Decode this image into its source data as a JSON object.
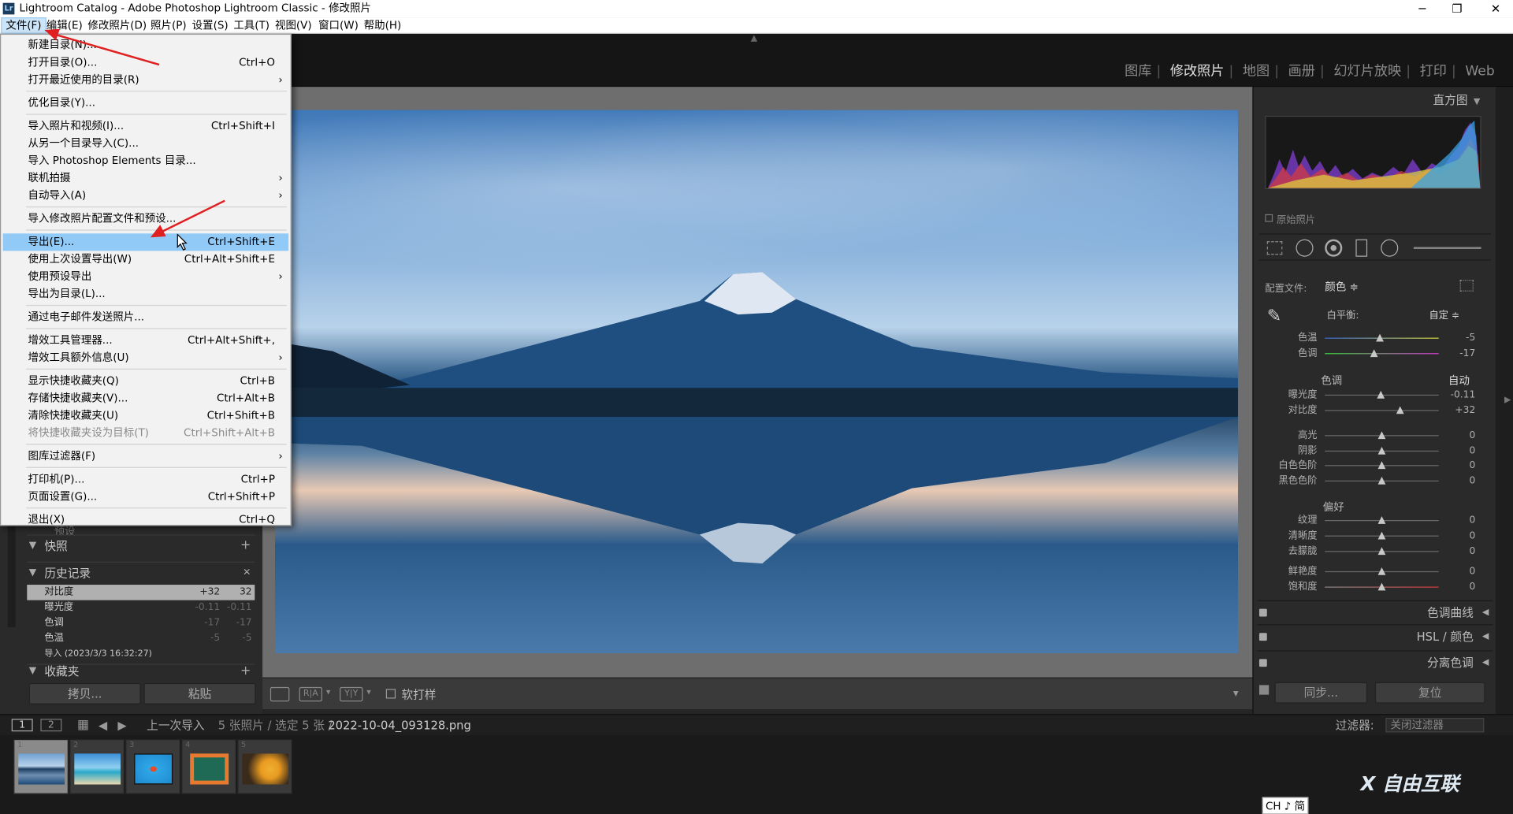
{
  "window": {
    "title": "Lightroom Catalog - Adobe Photoshop Lightroom Classic - 修改照片",
    "logo_text": "Lr",
    "minimize": "─",
    "maximize": "❐",
    "close": "✕"
  },
  "menubar": [
    "文件(F)",
    "编辑(E)",
    "修改照片(D)",
    "照片(P)",
    "设置(S)",
    "工具(T)",
    "视图(V)",
    "窗口(W)",
    "帮助(H)"
  ],
  "modules": [
    "图库",
    "修改照片",
    "地图",
    "画册",
    "幻灯片放映",
    "打印",
    "Web"
  ],
  "module_separator": "|",
  "file_menu": {
    "items": [
      {
        "label": "新建目录(N)...",
        "shortcut": ""
      },
      {
        "label": "打开目录(O)...",
        "shortcut": "Ctrl+O"
      },
      {
        "label": "打开最近使用的目录(R)",
        "shortcut": "",
        "submenu": true
      },
      {
        "label": "优化目录(Y)...",
        "shortcut": ""
      },
      {
        "label": "导入照片和视频(I)...",
        "shortcut": "Ctrl+Shift+I"
      },
      {
        "label": "从另一个目录导入(C)...",
        "shortcut": ""
      },
      {
        "label": "导入 Photoshop Elements 目录...",
        "shortcut": ""
      },
      {
        "label": "联机拍摄",
        "shortcut": "",
        "submenu": true
      },
      {
        "label": "自动导入(A)",
        "shortcut": "",
        "submenu": true
      },
      {
        "label": "导入修改照片配置文件和预设...",
        "shortcut": ""
      },
      {
        "label": "导出(E)...",
        "shortcut": "Ctrl+Shift+E",
        "highlighted": true
      },
      {
        "label": "使用上次设置导出(W)",
        "shortcut": "Ctrl+Alt+Shift+E"
      },
      {
        "label": "使用预设导出",
        "shortcut": "",
        "submenu": true
      },
      {
        "label": "导出为目录(L)...",
        "shortcut": ""
      },
      {
        "label": "通过电子邮件发送照片...",
        "shortcut": ""
      },
      {
        "label": "增效工具管理器...",
        "shortcut": "Ctrl+Alt+Shift+,"
      },
      {
        "label": "增效工具额外信息(U)",
        "shortcut": "",
        "submenu": true
      },
      {
        "label": "显示快捷收藏夹(Q)",
        "shortcut": "Ctrl+B"
      },
      {
        "label": "存储快捷收藏夹(V)...",
        "shortcut": "Ctrl+Alt+B"
      },
      {
        "label": "清除快捷收藏夹(U)",
        "shortcut": "Ctrl+Shift+B"
      },
      {
        "label": "将快捷收藏夹设为目标(T)",
        "shortcut": "Ctrl+Shift+Alt+B",
        "disabled": true
      },
      {
        "label": "图库过滤器(F)",
        "shortcut": "",
        "submenu": true
      },
      {
        "label": "打印机(P)...",
        "shortcut": "Ctrl+P"
      },
      {
        "label": "页面设置(G)...",
        "shortcut": "Ctrl+Shift+P"
      },
      {
        "label": "退出(X)",
        "shortcut": "Ctrl+Q"
      }
    ],
    "submenu_arrow": "›"
  },
  "left_panel": {
    "partial_label": "预设",
    "snapshots": {
      "label": "快照",
      "action": "+"
    },
    "history": {
      "label": "历史记录",
      "action": "✕",
      "rows": [
        {
          "name": "对比度",
          "a": "+32",
          "b": "32"
        },
        {
          "name": "曝光度",
          "a": "-0.11",
          "b": "-0.11"
        },
        {
          "name": "色调",
          "a": "-17",
          "b": "-17"
        },
        {
          "name": "色温",
          "a": "-5",
          "b": "-5"
        },
        {
          "name": "导入 (2023/3/3 16:32:27)",
          "a": "",
          "b": ""
        }
      ]
    },
    "collections": {
      "label": "收藏夹",
      "action": "+"
    },
    "copy_button": "拷贝...",
    "paste_button": "粘贴"
  },
  "toolbar": {
    "ra": "R|A",
    "yy": "Y|Y",
    "softproof": "软打样",
    "dropdown": "▾"
  },
  "right_panel": {
    "histogram_title": "直方图",
    "original_photo": "原始照片",
    "profile_label": "配置文件:",
    "profile_value": "颜色 ≑",
    "wb_label": "白平衡:",
    "wb_value": "自定 ≑",
    "tone_label": "色调",
    "auto": "自动",
    "presence_label": "偏好",
    "sliders_wb": [
      {
        "label": "色温",
        "value": "-5",
        "pos": 0.48
      },
      {
        "label": "色调",
        "value": "-17",
        "pos": 0.43
      }
    ],
    "sliders_tone1": [
      {
        "label": "曝光度",
        "value": "-0.11",
        "pos": 0.49
      },
      {
        "label": "对比度",
        "value": "+32",
        "pos": 0.66
      }
    ],
    "sliders_tone2": [
      {
        "label": "高光",
        "value": "0",
        "pos": 0.5
      },
      {
        "label": "阴影",
        "value": "0",
        "pos": 0.5
      },
      {
        "label": "白色色阶",
        "value": "0",
        "pos": 0.5
      },
      {
        "label": "黑色色阶",
        "value": "0",
        "pos": 0.5
      }
    ],
    "sliders_presence1": [
      {
        "label": "纹理",
        "value": "0",
        "pos": 0.5
      },
      {
        "label": "清晰度",
        "value": "0",
        "pos": 0.5
      },
      {
        "label": "去朦胧",
        "value": "0",
        "pos": 0.5
      }
    ],
    "sliders_presence2": [
      {
        "label": "鲜艳度",
        "value": "0",
        "pos": 0.5
      },
      {
        "label": "饱和度",
        "value": "0",
        "pos": 0.5
      }
    ],
    "tone_curve": "色调曲线",
    "hsl": "HSL / 颜色",
    "split_toning": "分离色调",
    "sync_button": "同步...",
    "reset_button": "复位"
  },
  "filmstrip": {
    "page1": "1",
    "page2": "2",
    "source": "上一次导入",
    "info": "5 张照片 / 选定 5 张 /",
    "filename": "2022-10-04_093128.png",
    "filter_label": "过滤器:",
    "filter_value": "关闭过滤器",
    "thumb_numbers": [
      "1",
      "2",
      "3",
      "4",
      "5"
    ]
  },
  "ime": "CH ♪ 简",
  "watermark": "X 自由互联"
}
